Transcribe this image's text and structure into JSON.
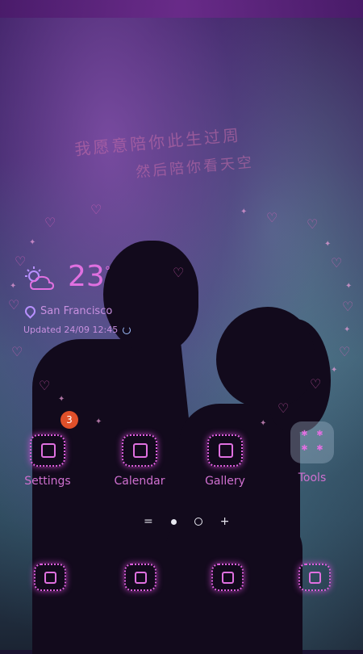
{
  "weather": {
    "temperature": "23",
    "degree": "°",
    "location": "San Francisco",
    "updated": "Updated 24/09 12:45"
  },
  "apps": [
    {
      "label": "Settings",
      "badge": "3"
    },
    {
      "label": "Calendar"
    },
    {
      "label": "Gallery"
    },
    {
      "label": "Tools"
    }
  ],
  "pager": {
    "menu": "=",
    "add": "+"
  },
  "dock": [
    "phone-icon",
    "messages-icon",
    "camera-icon",
    "browser-icon"
  ],
  "colors": {
    "accent": "#e070e0",
    "badge": "#e0502a"
  }
}
